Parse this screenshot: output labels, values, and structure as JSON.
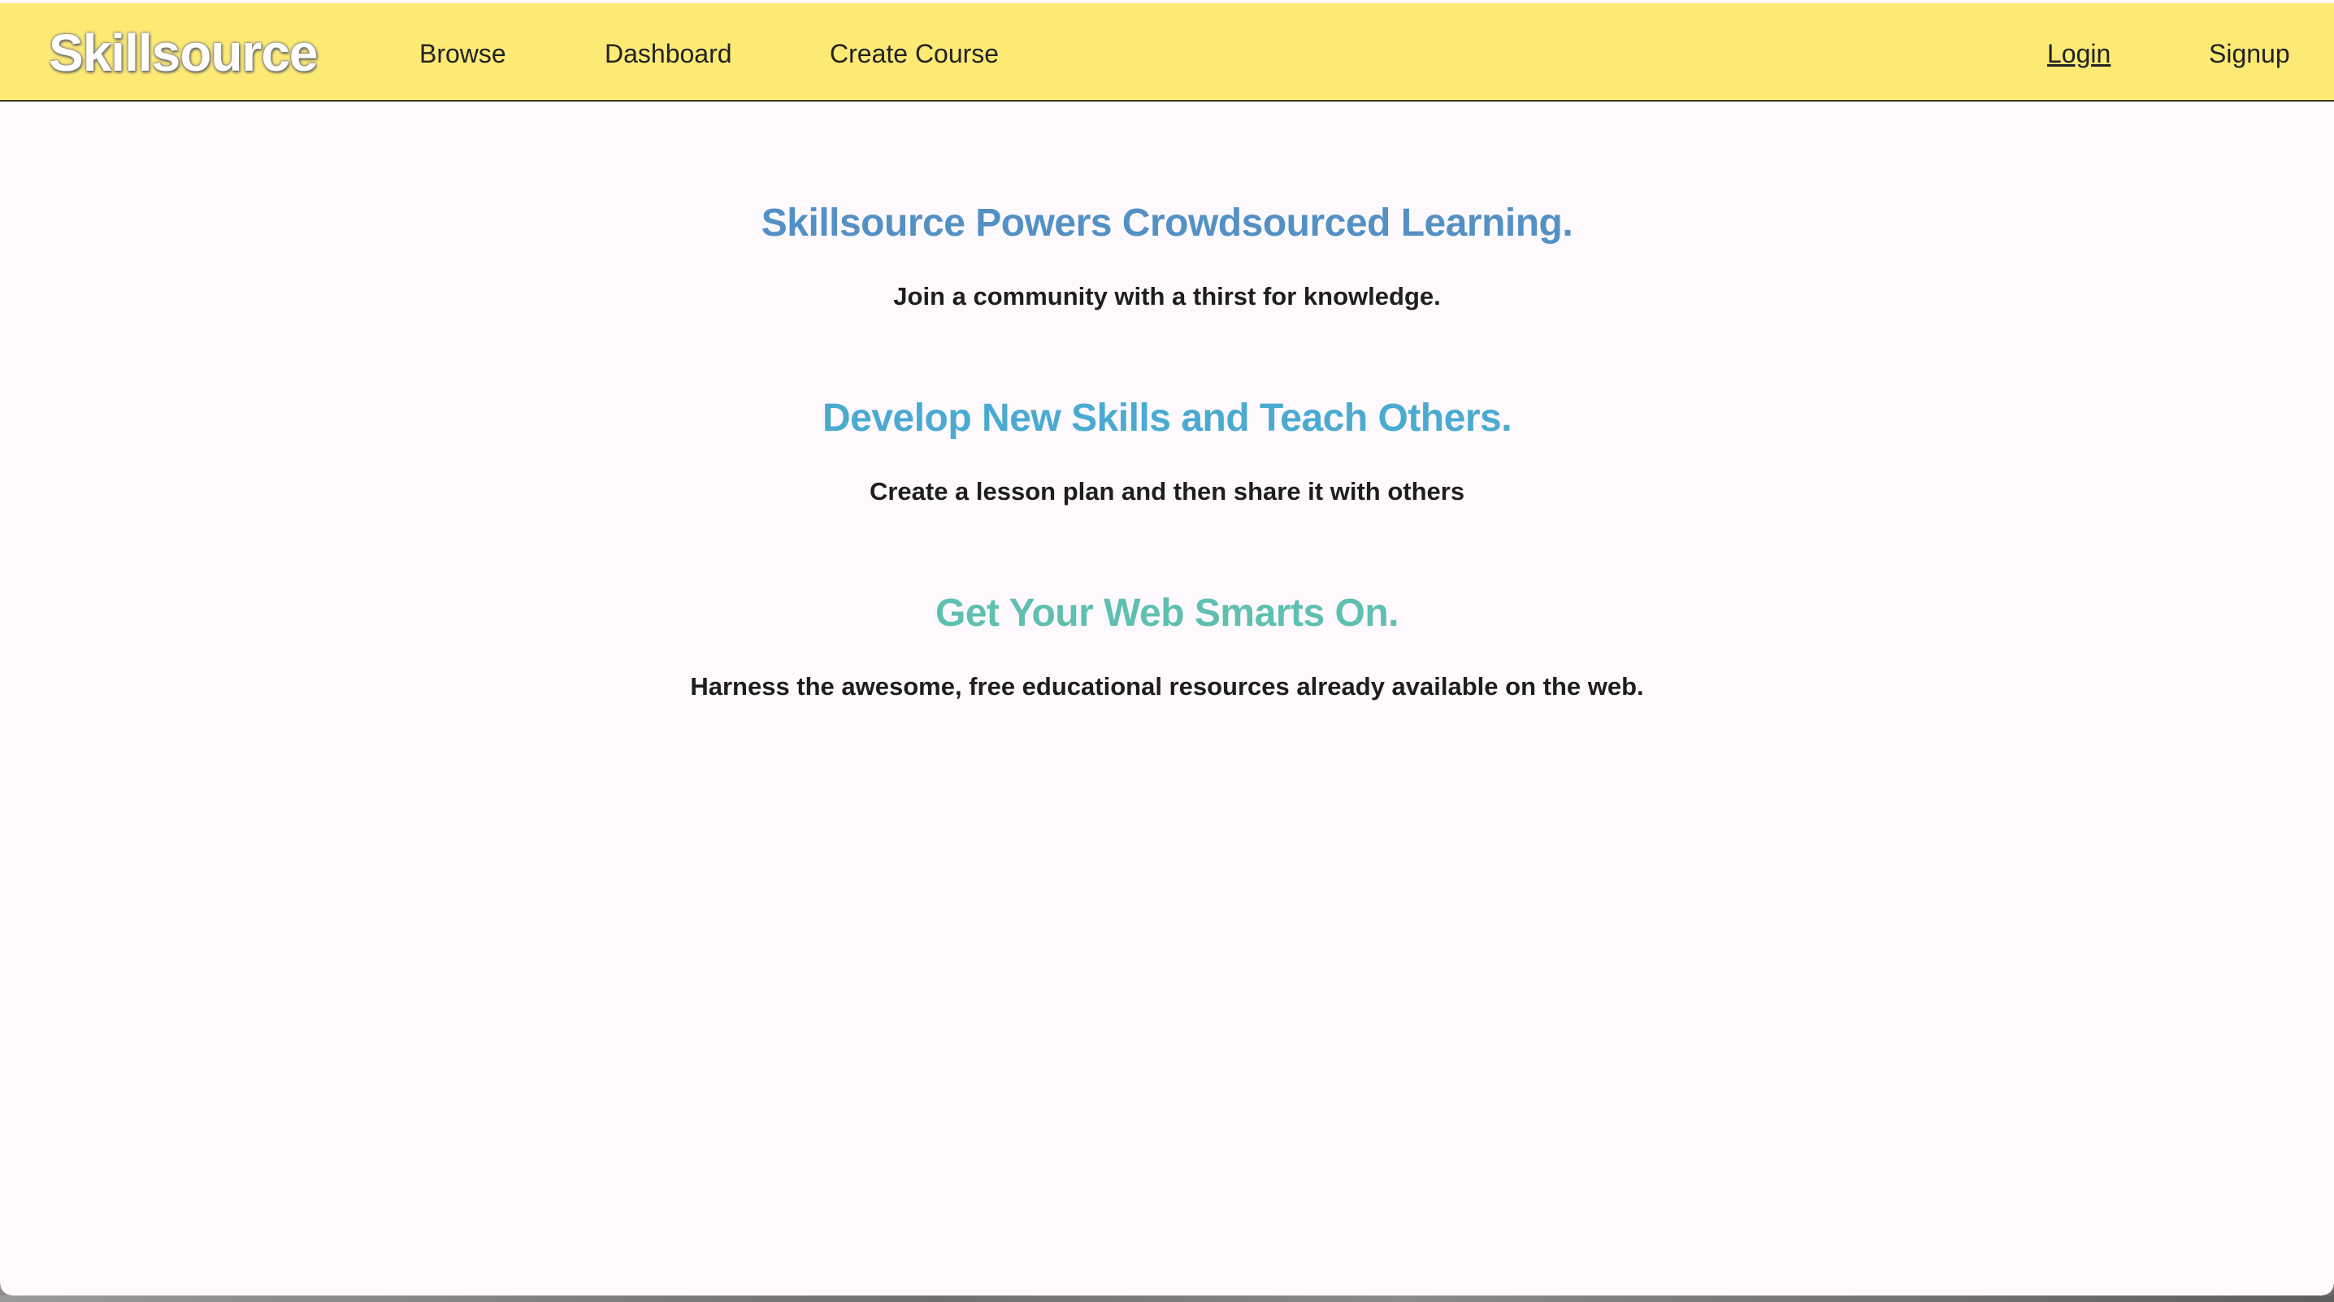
{
  "navbar": {
    "brand": "Skillsource",
    "links": {
      "browse": "Browse",
      "dashboard": "Dashboard",
      "create_course": "Create Course",
      "login": "Login",
      "signup": "Signup"
    },
    "background_color": "#fdea75"
  },
  "features": [
    {
      "title": "Skillsource Powers Crowdsourced Learning.",
      "text": "Join a community with a thirst for knowledge.",
      "title_color": "#5390c4"
    },
    {
      "title": "Develop New Skills and Teach Others.",
      "text": "Create a lesson plan and then share it with others",
      "title_color": "#4aaad0"
    },
    {
      "title": "Get Your Web Smarts On.",
      "text": "Harness the awesome, free educational resources already available on the web.",
      "title_color": "#5fbfb0"
    }
  ]
}
